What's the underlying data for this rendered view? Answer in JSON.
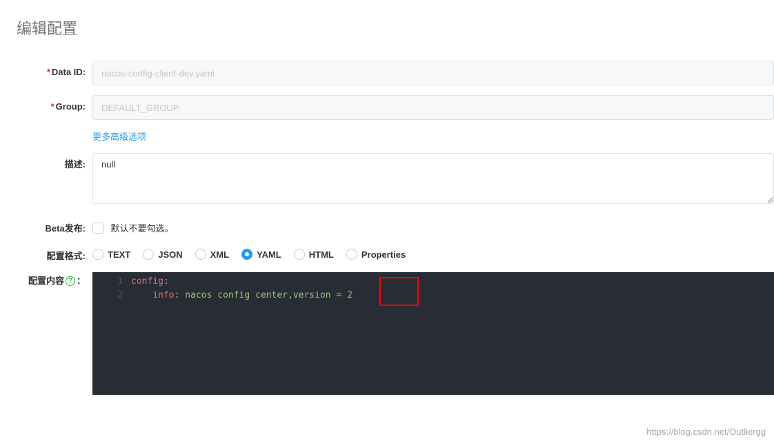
{
  "page": {
    "title": "编辑配置"
  },
  "form": {
    "dataId": {
      "label": "Data ID:",
      "value": "nacos-config-client-dev.yaml",
      "required": true
    },
    "group": {
      "label": "Group:",
      "value": "DEFAULT_GROUP",
      "required": true
    },
    "moreOptions": "更多高级选项",
    "description": {
      "label": "描述:",
      "value": "null"
    },
    "beta": {
      "label": "Beta发布:",
      "hint": "默认不要勾选。",
      "checked": false
    },
    "format": {
      "label": "配置格式:",
      "options": [
        "TEXT",
        "JSON",
        "XML",
        "YAML",
        "HTML",
        "Properties"
      ],
      "selected": "YAML"
    },
    "content": {
      "label": "配置内容",
      "colon": "：",
      "lines": [
        {
          "n": 1,
          "key": "config",
          "punct": ":",
          "text": ""
        },
        {
          "n": 2,
          "indent": "    ",
          "key": "info",
          "punct": ":",
          "text": " nacos config center,version = 2"
        }
      ],
      "raw": "config:\n    info: nacos config center,version = 2"
    }
  },
  "watermark": "https://blog.csdn.net/Outliergg"
}
